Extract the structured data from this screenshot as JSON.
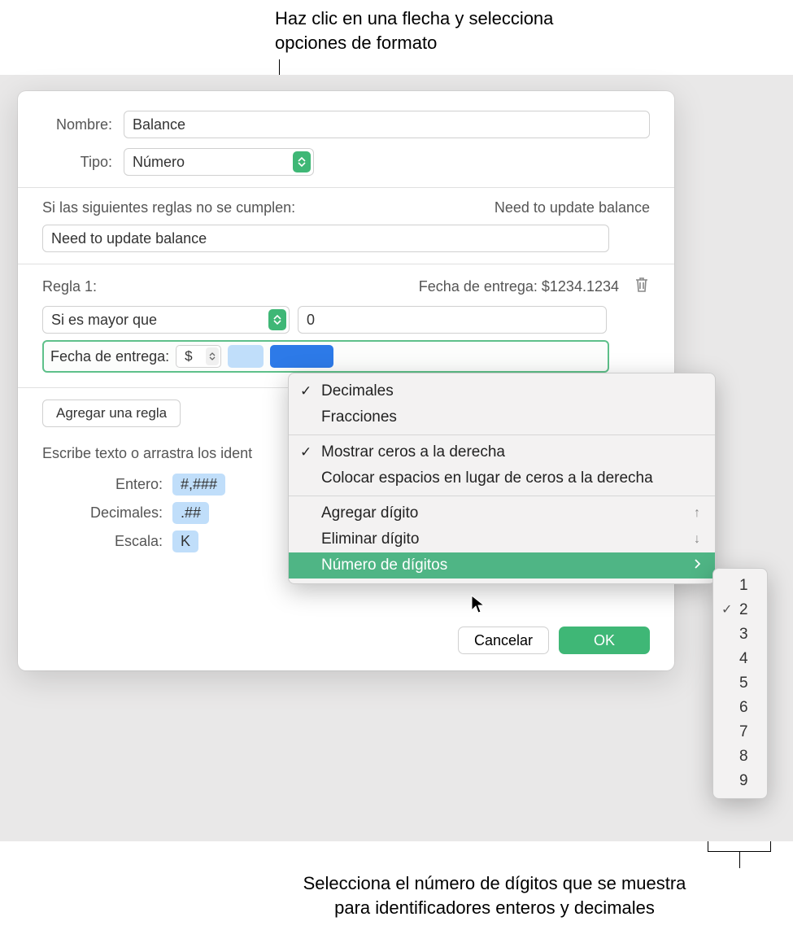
{
  "annotations": {
    "top_line1": "Haz clic en una flecha y selecciona",
    "top_line2": "opciones de formato",
    "bottom_line1": "Selecciona el número de dígitos que se muestra",
    "bottom_line2": "para identificadores enteros y decimales"
  },
  "dialog": {
    "name_label": "Nombre:",
    "name_value": "Balance",
    "type_label": "Tipo:",
    "type_value": "Número",
    "rules_intro": "Si las siguientes reglas no se cumplen:",
    "rules_preview": "Need to update balance",
    "rules_message_value": "Need to update balance",
    "rule1_label": "Regla 1:",
    "rule1_preview": "Fecha de entrega: $1234.1234",
    "rule1_condition": "Si es mayor que",
    "rule1_value": "0",
    "format_label": "Fecha de entrega:",
    "currency_symbol": "$",
    "add_rule": "Agregar una regla",
    "drag_hint": "Escribe texto o arrastra los ident",
    "tokens": {
      "entero_label": "Entero:",
      "entero_value": "#,###",
      "decimales_label": "Decimales:",
      "decimales_value": ".##",
      "escala_label": "Escala:",
      "escala_value": "K"
    },
    "cancel": "Cancelar",
    "ok": "OK"
  },
  "menu": {
    "decimales": "Decimales",
    "fracciones": "Fracciones",
    "mostrar_ceros": "Mostrar ceros a la derecha",
    "colocar_espacios": "Colocar espacios en lugar de ceros a la derecha",
    "agregar_digito": "Agregar dígito",
    "agregar_hint": "↑",
    "eliminar_digito": "Eliminar dígito",
    "eliminar_hint": "↓",
    "numero_digitos": "Número de dígitos"
  },
  "submenu": {
    "options": [
      "1",
      "2",
      "3",
      "4",
      "5",
      "6",
      "7",
      "8",
      "9"
    ],
    "checked_index": 1
  }
}
